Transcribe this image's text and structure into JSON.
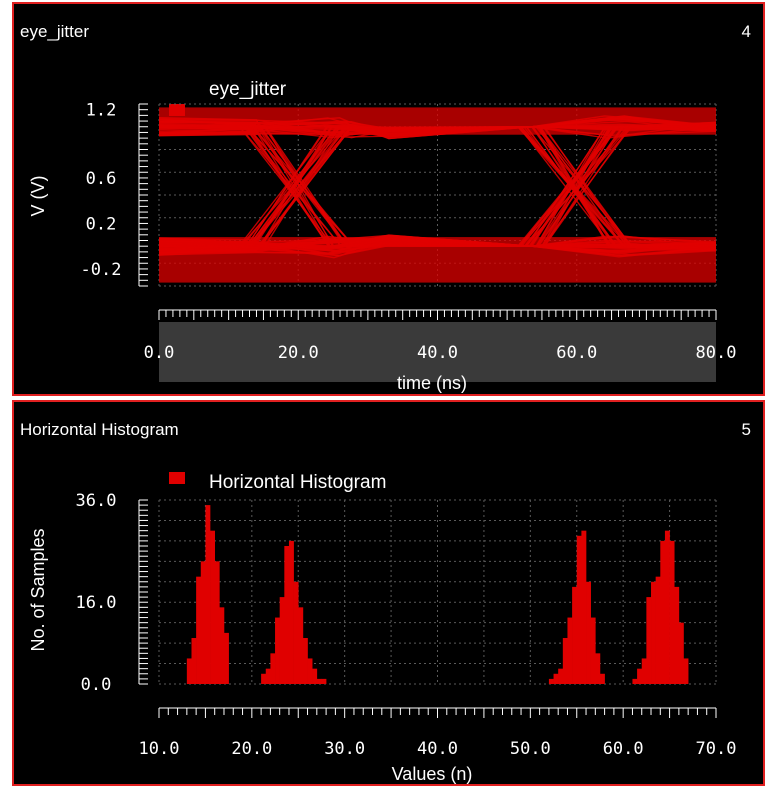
{
  "panels": [
    {
      "title": "eye_jitter",
      "number": "4"
    },
    {
      "title": "Horizontal Histogram",
      "number": "5"
    }
  ],
  "chart_data": [
    {
      "type": "line",
      "chart_kind": "eye diagram",
      "title": "eye_jitter",
      "legend": [
        "eye_jitter"
      ],
      "legend_placement": "top-left",
      "xlabel": "time (ns)",
      "ylabel": "V (V)",
      "xlim": [
        0,
        80
      ],
      "ylim": [
        -0.35,
        1.25
      ],
      "x_ticks": [
        "0.0",
        "20.0",
        "40.0",
        "60.0",
        "80.0"
      ],
      "y_ticks": [
        "1.2",
        "0.6",
        "0.2",
        "-0.2"
      ],
      "grid": true,
      "series_color": "#e00000",
      "levels": {
        "low": 0.0,
        "high": 1.05
      },
      "crossings_ns": [
        15.5,
        25,
        55.5,
        65
      ]
    },
    {
      "type": "bar",
      "title": "Horizontal Histogram",
      "legend": [
        "Horizontal Histogram"
      ],
      "legend_placement": "top-left",
      "xlabel": "Values (n)",
      "ylabel": "No. of Samples",
      "xlim": [
        10,
        70
      ],
      "ylim": [
        0,
        36
      ],
      "x_ticks": [
        "10.0",
        "20.0",
        "30.0",
        "40.0",
        "50.0",
        "60.0",
        "70.0"
      ],
      "y_ticks": [
        "36.0",
        "16.0",
        "0.0"
      ],
      "grid": true,
      "series_color": "#e00000",
      "bin_width": 0.5,
      "x": [
        13.25,
        13.75,
        14.25,
        14.75,
        15.25,
        15.75,
        16.25,
        16.75,
        17.25,
        21.25,
        21.75,
        22.25,
        22.75,
        23.25,
        23.75,
        24.25,
        24.75,
        25.25,
        25.75,
        26.25,
        26.75,
        27.25,
        27.75,
        52.25,
        52.75,
        53.25,
        53.75,
        54.25,
        54.75,
        55.25,
        55.75,
        56.25,
        56.75,
        57.25,
        57.75,
        61.25,
        61.75,
        62.25,
        62.75,
        63.25,
        63.75,
        64.25,
        64.75,
        65.25,
        65.75,
        66.25,
        66.75
      ],
      "values": [
        5,
        9,
        21,
        24,
        35,
        30,
        24,
        15,
        10,
        2,
        3,
        6,
        13,
        17,
        27,
        28,
        20,
        15,
        9,
        5,
        3,
        1,
        1,
        1,
        2,
        3,
        9,
        13,
        19,
        29,
        30,
        20,
        13,
        6,
        2,
        1,
        3,
        5,
        17,
        20,
        21,
        28,
        30,
        28,
        19,
        12,
        5
      ]
    }
  ]
}
